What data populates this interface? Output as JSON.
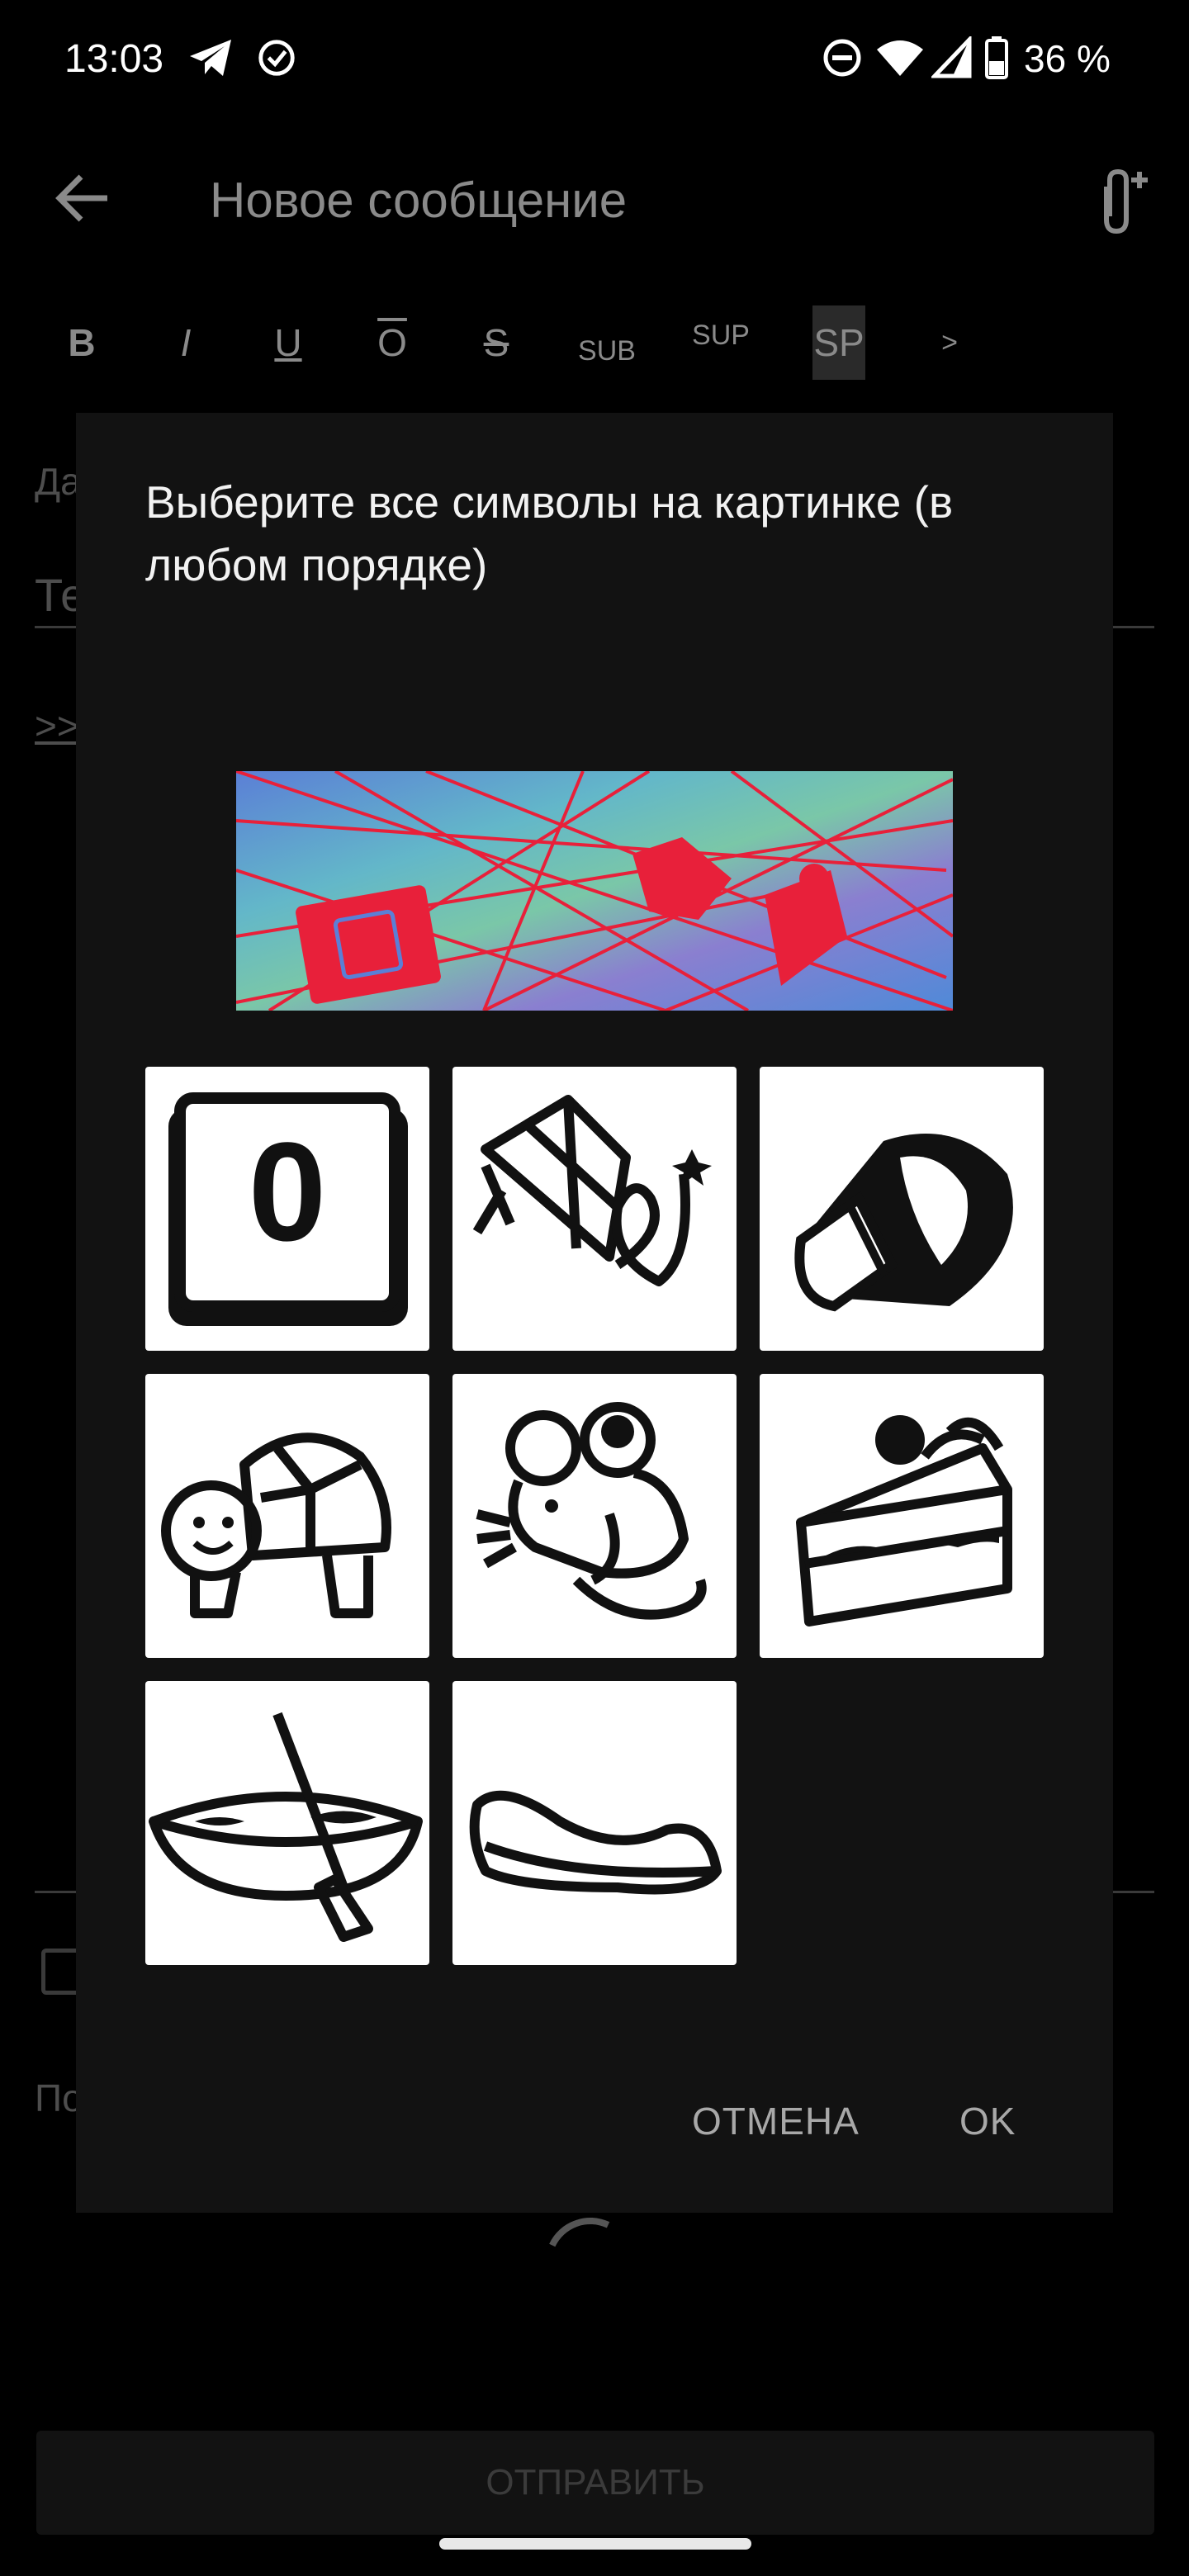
{
  "status_bar": {
    "time": "13:03",
    "battery": "36 %",
    "icons": [
      "telegram-icon",
      "check-circle-icon",
      "dnd-icon",
      "wifi-icon",
      "signal-icon",
      "battery-icon"
    ]
  },
  "toolbar": {
    "title": "Новое сообщение",
    "back_icon": "arrow-back-icon",
    "attach_icon": "attach-add-icon"
  },
  "format_bar": {
    "items": [
      "B",
      "I",
      "U",
      "O",
      "S",
      "SUB",
      "SUP",
      "SP",
      ">"
    ],
    "active": "SP"
  },
  "background_form": {
    "date_label": "Да",
    "subject_label": "Те",
    "quote_label": ">>",
    "footer_label": "По",
    "send_button": "ОТПРАВИТЬ"
  },
  "dialog": {
    "title": "Выберите все символы на картинке (в любом порядке)",
    "choices": [
      {
        "name": "key-zero"
      },
      {
        "name": "kite"
      },
      {
        "name": "megaphone"
      },
      {
        "name": "turtle"
      },
      {
        "name": "mouse"
      },
      {
        "name": "cake-slice"
      },
      {
        "name": "canoe"
      },
      {
        "name": "flat-shoe"
      }
    ],
    "cancel_label": "ОТМЕНА",
    "ok_label": "OK"
  },
  "colors": {
    "dialog_bg": "#121212",
    "captcha_line": "#e8203a",
    "captcha_bg": "#5a86c8"
  }
}
